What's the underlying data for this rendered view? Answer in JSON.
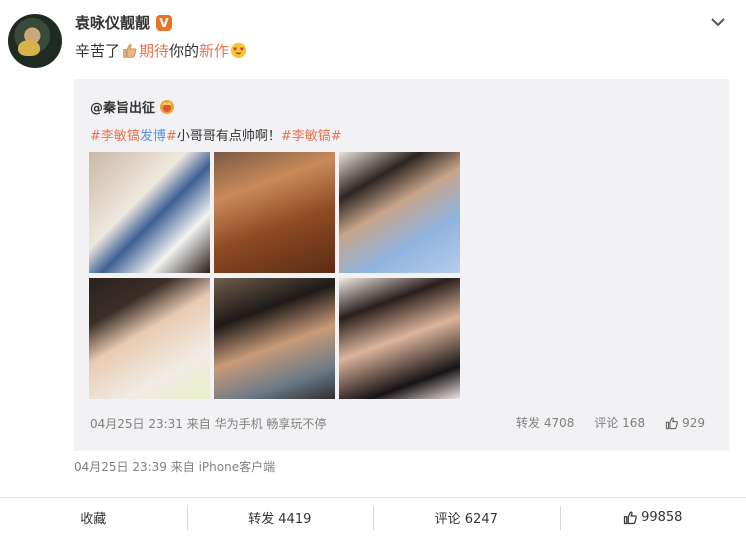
{
  "post": {
    "username": "袁咏仪靓靓",
    "verified_badge": "V",
    "text_part1": "辛苦了",
    "text_highlight1": "期待",
    "text_part2": "你的",
    "text_highlight2": "新作",
    "emoji_1": "thumbs-up",
    "emoji_2": "heart-eyes",
    "timestamp": "04月25日 23:39 来自 iPhone客户端"
  },
  "repost": {
    "username": "@秦旨出征",
    "tag1_open": "#",
    "tag1_name_a": "李敏镐",
    "tag1_name_b": "发博",
    "tag1_close": "#",
    "text": "小哥哥有点帅啊！",
    "tag2": "#李敏镐#",
    "photos": [
      "photo-1",
      "photo-2",
      "photo-3",
      "photo-4",
      "photo-5",
      "photo-6"
    ],
    "meta": "04月25日 23:31 来自 华为手机 畅享玩不停",
    "forward": "转发 4708",
    "comment": "评论 168",
    "likes": "929"
  },
  "footer": {
    "favorite": "收藏",
    "forward": "转发 4419",
    "comment": "评论 6247",
    "likes": "99858"
  }
}
